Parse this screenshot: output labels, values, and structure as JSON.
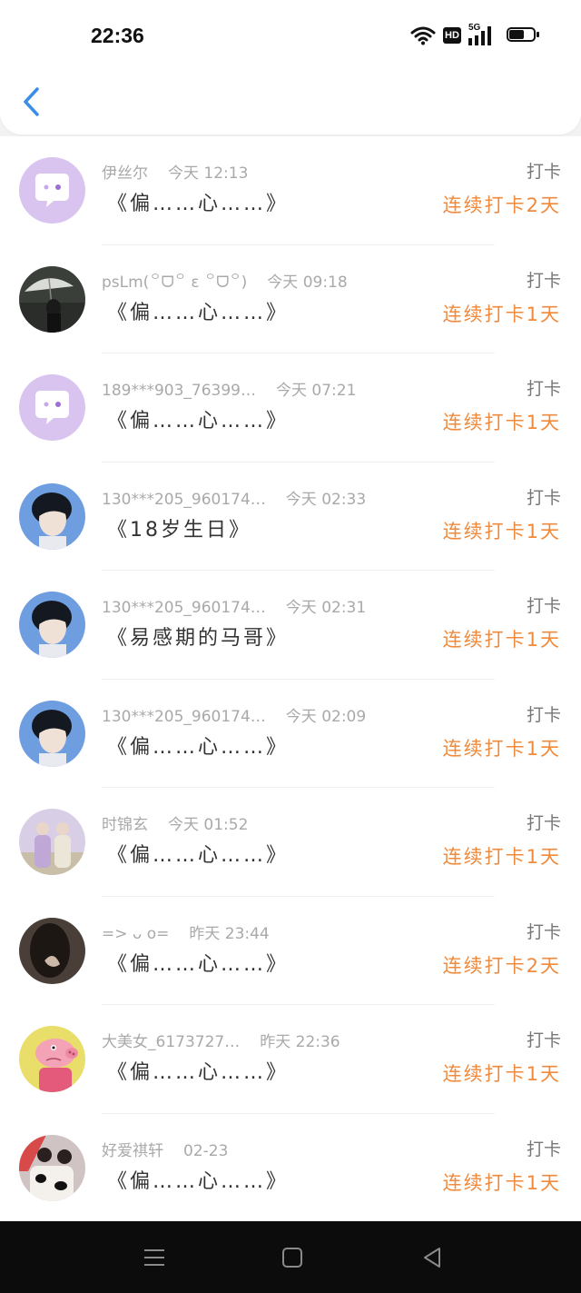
{
  "status_bar": {
    "time": "22:36",
    "icons": [
      "wifi-icon",
      "hd-icon",
      "5g-signal-icon",
      "battery-icon"
    ],
    "hd_label": "HD",
    "signal_label": "5G"
  },
  "header": {
    "back_icon": "chevron-left-icon"
  },
  "colors": {
    "accent": "#f08a3c",
    "back": "#3a8ee6",
    "name": "#a9a9a9"
  },
  "items": [
    {
      "name": "伊丝尔",
      "time": "今天 12:13",
      "title": "《偏……心……》",
      "type": "打卡",
      "streak": "连续打卡2天",
      "avatar": "chat-bubble"
    },
    {
      "name": "psLm(꒪ᗜ꒪ ε ꒪ᗜ꒪)",
      "time": "今天 09:18",
      "title": "《偏……心……》",
      "type": "打卡",
      "streak": "连续打卡1天",
      "avatar": "photo-umbrella"
    },
    {
      "name": "189***903_76399…",
      "time": "今天 07:21",
      "title": "《偏……心……》",
      "type": "打卡",
      "streak": "连续打卡1天",
      "avatar": "chat-bubble"
    },
    {
      "name": "130***205_960174…",
      "time": "今天 02:33",
      "title": "《18岁生日》",
      "type": "打卡",
      "streak": "连续打卡1天",
      "avatar": "photo-boy-blue"
    },
    {
      "name": "130***205_960174…",
      "time": "今天 02:31",
      "title": "《易感期的马哥》",
      "type": "打卡",
      "streak": "连续打卡1天",
      "avatar": "photo-boy-blue"
    },
    {
      "name": "130***205_960174…",
      "time": "今天 02:09",
      "title": "《偏……心……》",
      "type": "打卡",
      "streak": "连续打卡1天",
      "avatar": "photo-boy-blue"
    },
    {
      "name": "时锦玄",
      "time": "今天 01:52",
      "title": "《偏……心……》",
      "type": "打卡",
      "streak": "连续打卡1天",
      "avatar": "photo-couple"
    },
    {
      "name": "=> ᴗ o=",
      "time": "昨天 23:44",
      "title": "《偏……心……》",
      "type": "打卡",
      "streak": "连续打卡2天",
      "avatar": "photo-dark-hair"
    },
    {
      "name": "大美女_6173727…",
      "time": "昨天 22:36",
      "title": "《偏……心……》",
      "type": "打卡",
      "streak": "连续打卡1天",
      "avatar": "peppa-pig"
    },
    {
      "name": "好爱祺轩",
      "time": "02-23",
      "title": "《偏……心……》",
      "type": "打卡",
      "streak": "连续打卡1天",
      "avatar": "photo-pair-cow"
    }
  ],
  "nav_bar": {
    "icons": [
      "menu-icon",
      "home-icon",
      "back-triangle-icon"
    ]
  }
}
